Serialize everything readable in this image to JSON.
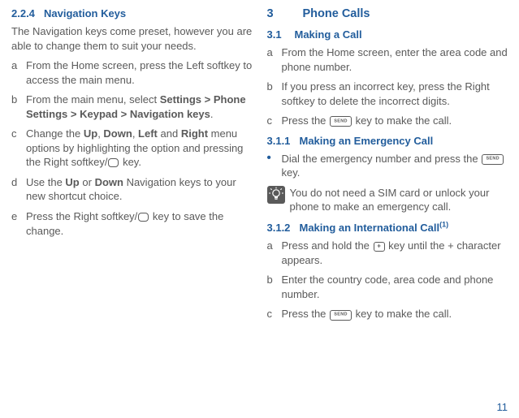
{
  "left": {
    "hnum": "2.2.4",
    "htitle": "Navigation Keys",
    "intro": "The Navigation keys come preset, however you are able to change them to suit your needs.",
    "item_a": "From the Home screen, press the Left softkey to access the main menu.",
    "item_b_pre": "From the main menu, select ",
    "item_b_bold": "Settings > Phone Settings > Keypad > Navigation keys",
    "item_b_post": ".",
    "item_c_1": "Change the ",
    "item_c_up": "Up",
    "item_c_2": ", ",
    "item_c_down": "Down",
    "item_c_3": ", ",
    "item_c_left": "Left",
    "item_c_4": " and ",
    "item_c_right": "Right",
    "item_c_5": " menu options by highlighting the option and pressing the Right softkey/",
    "item_c_6": " key.",
    "item_d_1": "Use the ",
    "item_d_up": "Up",
    "item_d_2": " or ",
    "item_d_down": "Down",
    "item_d_3": " Navigation keys to your new shortcut choice.",
    "item_e_1": "Press the Right softkey/",
    "item_e_2": " key to save the change."
  },
  "right": {
    "chnum": "3",
    "chtitle": "Phone Calls",
    "s31num": "3.1",
    "s31title": "Making a Call",
    "s31_a": "From the Home screen, enter the area code and phone number.",
    "s31_b": "If you press an incorrect key, press the Right softkey to delete the incorrect digits.",
    "s31_c_1": "Press the ",
    "s31_c_2": " key to make the call.",
    "s311num": "3.1.1",
    "s311title": "Making an Emergency Call",
    "s311_bullet_1": "Dial the emergency number and press the ",
    "s311_bullet_2": " key.",
    "s311_tip": "You do not need a SIM card or unlock your phone to make an emergency call.",
    "s312num": "3.1.2",
    "s312title_1": "Making an International Call",
    "s312title_sup": "(1)",
    "s312_a_1": "Press and hold the ",
    "s312_a_2": " key until the + character appears.",
    "s312_b": "Enter the country code, area code and phone number.",
    "s312_c_1": "Press the ",
    "s312_c_2": " key to make the call."
  },
  "markers": {
    "a": "a",
    "b": "b",
    "c": "c",
    "d": "d",
    "e": "e",
    "bullet": "•"
  },
  "pagenum": "11"
}
